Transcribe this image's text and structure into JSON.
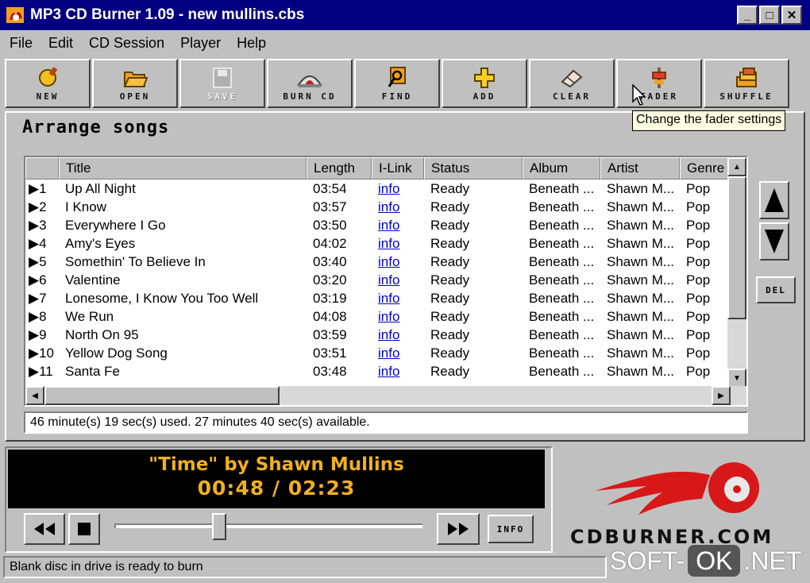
{
  "window": {
    "title": "MP3 CD Burner 1.09 - new mullins.cbs"
  },
  "menu": [
    "File",
    "Edit",
    "CD Session",
    "Player",
    "Help"
  ],
  "toolbar": {
    "new": "NEW",
    "open": "OPEN",
    "save": "SAVE",
    "burn": "BURN CD",
    "find": "FIND",
    "add": "ADD",
    "clear": "CLEAR",
    "fader": "FADER",
    "shuffle": "SHUFFLE"
  },
  "tooltip": "Change the fader settings",
  "section_title": "Arrange songs",
  "table": {
    "headers": [
      "Title",
      "Length",
      "I-Link",
      "Status",
      "Album",
      "Artist",
      "Genre"
    ],
    "rows": [
      {
        "n": "1",
        "title": "Up All Night",
        "length": "03:54",
        "link": "info",
        "status": "Ready",
        "album": "Beneath ...",
        "artist": "Shawn M...",
        "genre": "Pop"
      },
      {
        "n": "2",
        "title": "I Know",
        "length": "03:57",
        "link": "info",
        "status": "Ready",
        "album": "Beneath ...",
        "artist": "Shawn M...",
        "genre": "Pop"
      },
      {
        "n": "3",
        "title": "Everywhere I Go",
        "length": "03:50",
        "link": "info",
        "status": "Ready",
        "album": "Beneath ...",
        "artist": "Shawn M...",
        "genre": "Pop"
      },
      {
        "n": "4",
        "title": "Amy's Eyes",
        "length": "04:02",
        "link": "info",
        "status": "Ready",
        "album": "Beneath ...",
        "artist": "Shawn M...",
        "genre": "Pop"
      },
      {
        "n": "5",
        "title": "Somethin' To Believe In",
        "length": "03:40",
        "link": "info",
        "status": "Ready",
        "album": "Beneath ...",
        "artist": "Shawn M...",
        "genre": "Pop"
      },
      {
        "n": "6",
        "title": "Valentine",
        "length": "03:20",
        "link": "info",
        "status": "Ready",
        "album": "Beneath ...",
        "artist": "Shawn M...",
        "genre": "Pop"
      },
      {
        "n": "7",
        "title": "Lonesome, I Know You Too Well",
        "length": "03:19",
        "link": "info",
        "status": "Ready",
        "album": "Beneath ...",
        "artist": "Shawn M...",
        "genre": "Pop"
      },
      {
        "n": "8",
        "title": "We Run",
        "length": "04:08",
        "link": "info",
        "status": "Ready",
        "album": "Beneath ...",
        "artist": "Shawn M...",
        "genre": "Pop"
      },
      {
        "n": "9",
        "title": "North On 95",
        "length": "03:59",
        "link": "info",
        "status": "Ready",
        "album": "Beneath ...",
        "artist": "Shawn M...",
        "genre": "Pop"
      },
      {
        "n": "10",
        "title": "Yellow Dog Song",
        "length": "03:51",
        "link": "info",
        "status": "Ready",
        "album": "Beneath ...",
        "artist": "Shawn M...",
        "genre": "Pop"
      },
      {
        "n": "11",
        "title": "Santa Fe",
        "length": "03:48",
        "link": "info",
        "status": "Ready",
        "album": "Beneath ...",
        "artist": "Shawn M...",
        "genre": "Pop"
      }
    ]
  },
  "usage_text": "46 minute(s) 19 sec(s) used.    27 minutes 40 sec(s) available.",
  "side": {
    "del": "DEL"
  },
  "player": {
    "now_playing": "\"Time\" by Shawn Mullins",
    "time": "00:48 / 02:23",
    "position_fraction": 0.34,
    "info": "INFO"
  },
  "logo": "CDBURNER.COM",
  "statusbar": "Blank disc in drive is ready to burn",
  "watermark": {
    "left": "SOFT-",
    "box": "OK",
    "right": ".NET"
  },
  "colors": {
    "title_bar": "#000080",
    "display_text": "#f0b020",
    "link": "#0000cc",
    "logo_red": "#d81818"
  }
}
